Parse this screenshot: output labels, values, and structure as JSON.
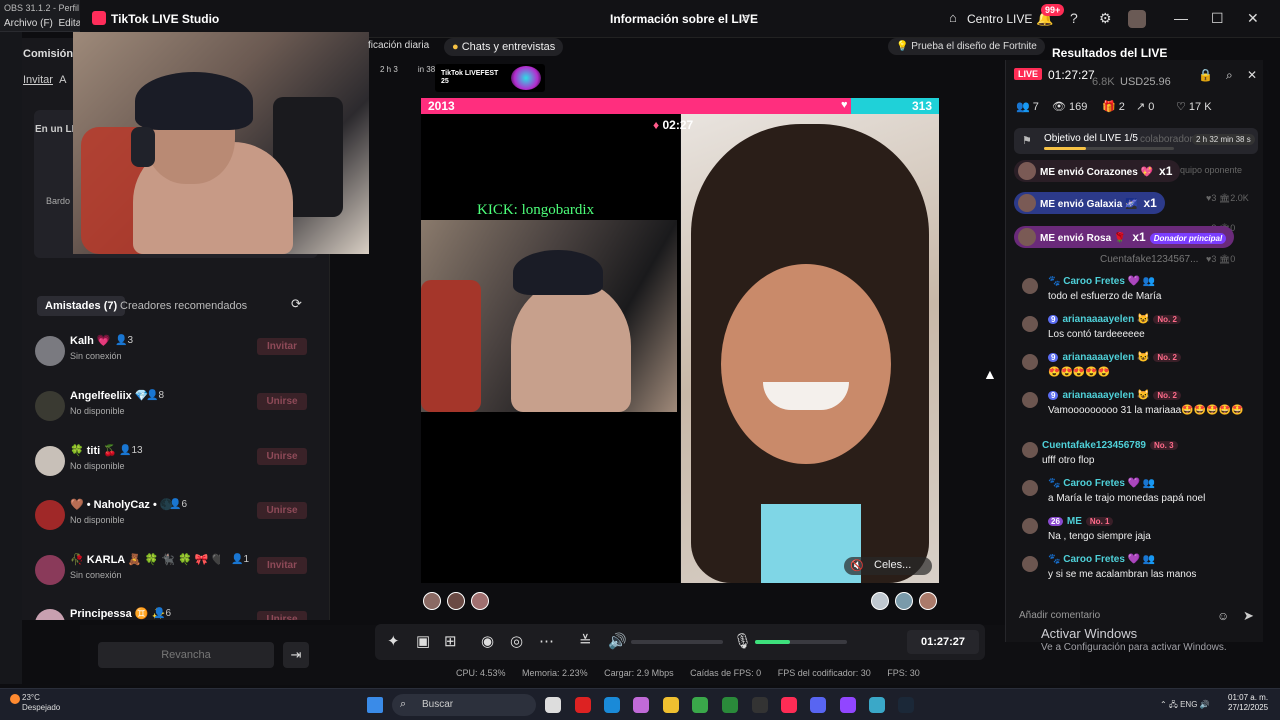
{
  "obs": {
    "title": "OBS 31.1.2 - Perfil",
    "menu_file": "Archivo (F)",
    "menu_edit": "Editar"
  },
  "window": {
    "app_title": "TikTok LIVE Studio",
    "center_title": "Información sobre el LIVE",
    "centro_live": "Centro LIVE",
    "notif_badge": "99+"
  },
  "left_panel": {
    "header": "Comisión",
    "tab_invite": "Invitar",
    "tab_other": "A",
    "card_title": "En un LI",
    "card_user": "Bardo",
    "friends_tab": "Amistades (7)",
    "recommended_tab": "Creadores recomendados",
    "friends": [
      {
        "name": "Kalh 💗",
        "count": "3",
        "status": "Sin conexión",
        "button": "Invitar"
      },
      {
        "name": "Angelfeeliix 💎",
        "count": "8",
        "status": "No disponible",
        "button": "Unirse"
      },
      {
        "name": "🍀 titi 🍒",
        "count": "13",
        "status": "No disponible",
        "button": "Unirse"
      },
      {
        "name": "🤎 • NaholyCaz • 🌑",
        "count": "6",
        "status": "No disponible",
        "button": "Unirse"
      },
      {
        "name": "🥀 KARLA 🧸 🍀 🐈‍⬛ 🍀 🎀 🖤 🐇🎵",
        "count": "1",
        "status": "Sin conexión",
        "button": "Invitar"
      },
      {
        "name": "Principessa ♊ ✨",
        "count": "6",
        "status": "",
        "button": "Unirse"
      }
    ],
    "revancha": "Revancha"
  },
  "top_bar": {
    "tab_partial": "ficación diaria",
    "chats": "Chats y entrevistas",
    "fortnite": "Prueba el diseño de Fortnite",
    "results": "Resultados del LIVE",
    "timer_small": "2 h 3",
    "timer_small2": "in 38 s",
    "fest_label": "TikTok LIVEFEST 25"
  },
  "battle": {
    "left_score": "2013",
    "right_score": "313",
    "left_fraction": 0.83,
    "timer": "02:27",
    "kick_text": "KICK: longobardix",
    "guest_name": "Celes..."
  },
  "controls": {
    "clock": "01:27:27",
    "mic_level": 0.38
  },
  "stats": {
    "cpu": "CPU: 4.53%",
    "mem": "Memoria: 2.23%",
    "load": "Cargar: 2.9 Mbps",
    "drops": "Caídas de FPS: 0",
    "enc": "FPS del codificador: 30",
    "fps": "FPS: 30"
  },
  "live_panel": {
    "live_tag": "LIVE",
    "time": "01:27:27",
    "usd": "USD25.96",
    "viewers_partial": "6.8K",
    "stat_people": "7",
    "stat_views": "169",
    "stat_gifts": "2",
    "stat_shares": "0",
    "stat_likes": "17 K",
    "goal_title": "Objetivo del LIVE 1/5",
    "goal_bg": "colaboradores",
    "goal_time": "2 h 32 min 38 s",
    "goal_progress": 0.32,
    "gifts": [
      {
        "text": "ME envió Corazones",
        "mult": "x1",
        "color": "#3a2230",
        "extra": ""
      },
      {
        "text": "ME envió Galaxia",
        "mult": "x1",
        "color": "#2c3a8a",
        "extra": ""
      },
      {
        "text": "ME envió Rosa",
        "mult": "x1",
        "color": "#6a2a7a",
        "extra": "Donador principal"
      }
    ],
    "bg_opponent": "quipo oponente",
    "bg_score1": "3",
    "bg_score1b": "2.0K",
    "bg_score2": "3",
    "bg_score2b": "0",
    "bg_score3": "3",
    "bg_score3b": "0",
    "bg_user": "Cuentafake1234567...",
    "comments": [
      {
        "user": "Caroo Fretes 💜",
        "lvl": "",
        "no": "",
        "msg": "todo el esfuerzo de María"
      },
      {
        "user": "arianaaaayelen 😺",
        "lvl": "9",
        "no": "No. 2",
        "msg": "Los contó tardeeeeee"
      },
      {
        "user": "arianaaaayelen 😺",
        "lvl": "9",
        "no": "No. 2",
        "msg": "😍😍😍😍😍"
      },
      {
        "user": "arianaaaayelen 😺",
        "lvl": "9",
        "no": "No. 2",
        "msg": "Vamooooooooo 31 la mariaaa🤩🤩🤩🤩🤩"
      },
      {
        "user": "Cuentafake123456789",
        "lvl": "",
        "no": "No. 3",
        "msg": "ufff otro flop"
      },
      {
        "user": "Caroo Fretes 💜",
        "lvl": "",
        "no": "",
        "msg": "a María le trajo monedas papá noel"
      },
      {
        "user": "ME",
        "lvl": "26",
        "no": "No. 1",
        "msg": "Na , tengo siempre jaja"
      },
      {
        "user": "Caroo Fretes 💜",
        "lvl": "",
        "no": "",
        "msg": "y si se me acalambran las manos"
      }
    ],
    "comment_placeholder": "Añadir comentario",
    "activate_windows": "Activar Windows",
    "activate_sub": "Ve a Configuración para activar Windows."
  },
  "taskbar": {
    "weather_temp": "23°C",
    "weather_desc": "Despejado",
    "search": "Buscar",
    "lang": "ENG",
    "time": "01:07 a. m.",
    "date": "27/12/2025"
  },
  "colors": {
    "accent": "#fe2c55",
    "battle_left": "#ff2e7e",
    "battle_right": "#1fd1d8",
    "link": "#4fd1d9"
  }
}
